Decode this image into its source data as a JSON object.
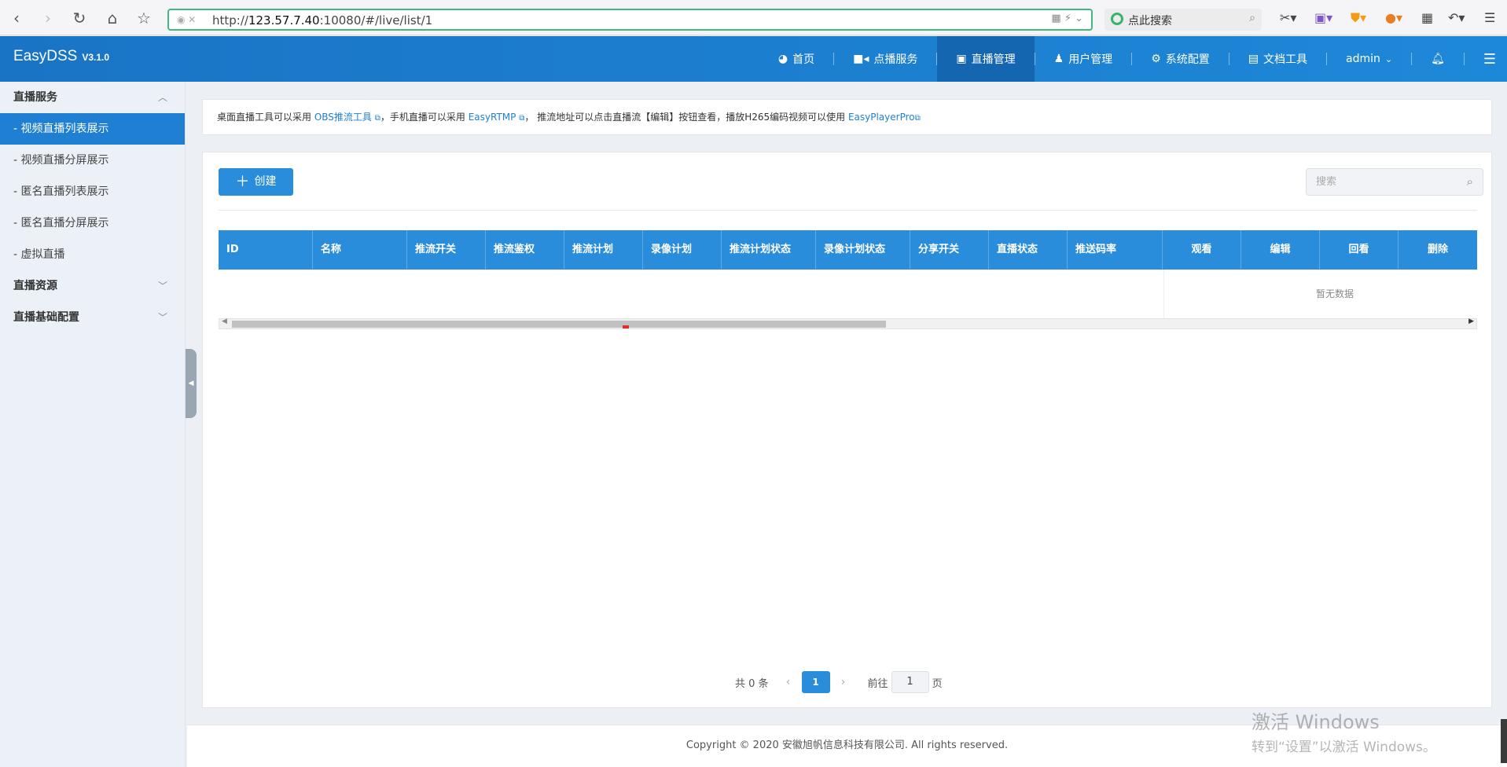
{
  "browser": {
    "url_prefix": "http://",
    "url_host": "123.57.7.40",
    "url_rest": ":10080/#/live/list/1",
    "search_placeholder": "点此搜索"
  },
  "header": {
    "logo": "EasyDSS",
    "version": "V3.1.0",
    "nav": [
      {
        "label": "首页",
        "icon": "dashboard-icon"
      },
      {
        "label": "点播服务",
        "icon": "video-camera-icon"
      },
      {
        "label": "直播管理",
        "icon": "calendar-icon"
      },
      {
        "label": "用户管理",
        "icon": "user-icon"
      },
      {
        "label": "系统配置",
        "icon": "gear-icon"
      },
      {
        "label": "文档工具",
        "icon": "book-icon"
      }
    ],
    "user": "admin"
  },
  "sidebar": {
    "group1": "直播服务",
    "items": [
      "- 视频直播列表展示",
      "- 视频直播分屏展示",
      "- 匿名直播列表展示",
      "- 匿名直播分屏展示",
      "- 虚拟直播"
    ],
    "group2": "直播资源",
    "group3": "直播基础配置"
  },
  "notice": {
    "t1": "桌面直播工具可以采用 ",
    "link1": "OBS推流工具",
    "t2": "，手机直播可以采用 ",
    "link2": "EasyRTMP",
    "t3": "，   推流地址可以点击直播流【编辑】按钮查看，播放H265编码视频可以使用 ",
    "link3": "EasyPlayerPro"
  },
  "toolbar": {
    "create_label": "创建",
    "search_placeholder": "搜索"
  },
  "table": {
    "columns": [
      "ID",
      "名称",
      "推流开关",
      "推流鉴权",
      "推流计划",
      "录像计划",
      "推流计划状态",
      "录像计划状态",
      "分享开关",
      "直播状态",
      "推送码率",
      "观看",
      "编辑",
      "回看",
      "删除"
    ],
    "empty_text": "暂无数据"
  },
  "pager": {
    "total": "共 0 条",
    "current": "1",
    "goto_label": "前往",
    "goto_value": "1",
    "page_suffix": "页"
  },
  "footer": {
    "copyright": "Copyright © 2020 安徽旭帆信息科技有限公司. All rights reserved."
  },
  "watermark": {
    "line1": "激活 Windows",
    "line2": "转到“设置”以激活 Windows。"
  }
}
